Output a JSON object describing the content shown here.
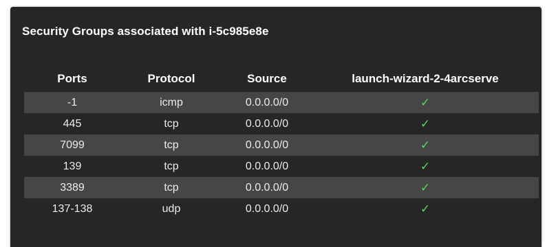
{
  "panel": {
    "title": "Security Groups associated with i-5c985e8e"
  },
  "table": {
    "headers": {
      "ports": "Ports",
      "protocol": "Protocol",
      "source": "Source",
      "group": "launch-wizard-2-4arcserve"
    },
    "rows": [
      {
        "ports": "-1",
        "protocol": "icmp",
        "source": "0.0.0.0/0",
        "check": "✓"
      },
      {
        "ports": "445",
        "protocol": "tcp",
        "source": "0.0.0.0/0",
        "check": "✓"
      },
      {
        "ports": "7099",
        "protocol": "tcp",
        "source": "0.0.0.0/0",
        "check": "✓"
      },
      {
        "ports": "139",
        "protocol": "tcp",
        "source": "0.0.0.0/0",
        "check": "✓"
      },
      {
        "ports": "3389",
        "protocol": "tcp",
        "source": "0.0.0.0/0",
        "check": "✓"
      },
      {
        "ports": "137-138",
        "protocol": "udp",
        "source": "0.0.0.0/0",
        "check": "✓"
      }
    ]
  },
  "colors": {
    "panel_bg": "#262626",
    "stripe_bg": "#464646",
    "check": "#5fd35f"
  },
  "icons": {
    "check": "check-icon"
  }
}
